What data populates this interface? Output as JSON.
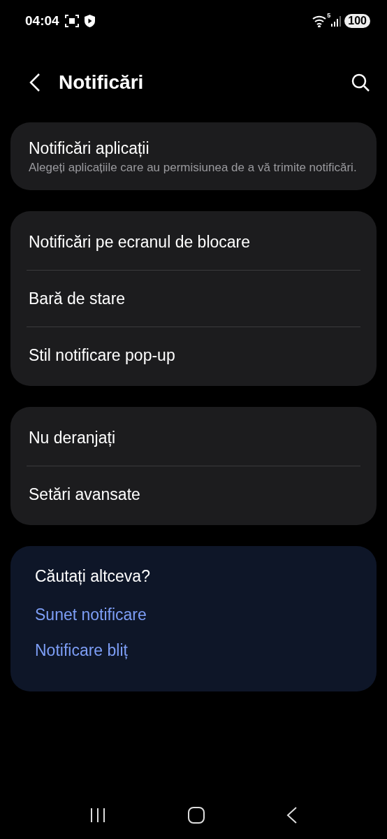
{
  "status_bar": {
    "time": "04:04",
    "wifi_label": "5",
    "battery": "100"
  },
  "header": {
    "title": "Notificări"
  },
  "groups": [
    {
      "items": [
        {
          "title": "Notificări aplicații",
          "subtitle": "Alegeți aplicațiile care au permisiunea de a vă trimite notificări."
        }
      ]
    },
    {
      "items": [
        {
          "title": "Notificări pe ecranul de blocare"
        },
        {
          "title": "Bară de stare"
        },
        {
          "title": "Stil notificare pop-up"
        }
      ]
    },
    {
      "items": [
        {
          "title": "Nu deranjați"
        },
        {
          "title": "Setări avansate"
        }
      ]
    }
  ],
  "suggestions": {
    "heading": "Căutați altceva?",
    "links": [
      "Sunet notificare",
      "Notificare bliț"
    ]
  }
}
